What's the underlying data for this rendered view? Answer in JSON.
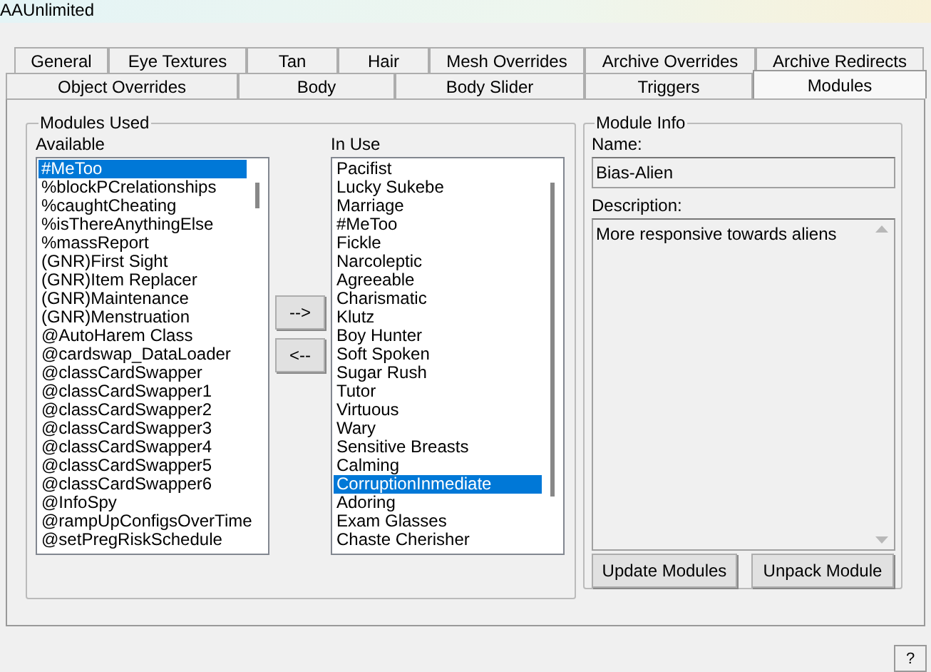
{
  "window": {
    "title": "AAUnlimited"
  },
  "tab_rows": [
    [
      {
        "label": "General",
        "selected": false
      },
      {
        "label": "Eye Textures",
        "selected": false
      },
      {
        "label": "Tan",
        "selected": false
      },
      {
        "label": "Hair",
        "selected": false
      },
      {
        "label": "Mesh Overrides",
        "selected": false
      },
      {
        "label": "Archive Overrides",
        "selected": false
      },
      {
        "label": "Archive Redirects",
        "selected": false
      }
    ],
    [
      {
        "label": "Object Overrides",
        "selected": false
      },
      {
        "label": "Body",
        "selected": false
      },
      {
        "label": "Body Slider",
        "selected": false
      },
      {
        "label": "Triggers",
        "selected": false
      },
      {
        "label": "Modules",
        "selected": true
      }
    ]
  ],
  "modules_used": {
    "title": "Modules Used",
    "available": {
      "label": "Available",
      "items": [
        {
          "text": "#MeToo",
          "selected": true
        },
        {
          "text": "%blockPCrelationships",
          "selected": false
        },
        {
          "text": "%caughtCheating",
          "selected": false
        },
        {
          "text": "%isThereAnythingElse",
          "selected": false
        },
        {
          "text": "%massReport",
          "selected": false
        },
        {
          "text": "(GNR)First Sight",
          "selected": false
        },
        {
          "text": "(GNR)Item Replacer",
          "selected": false
        },
        {
          "text": "(GNR)Maintenance",
          "selected": false
        },
        {
          "text": "(GNR)Menstruation",
          "selected": false
        },
        {
          "text": "@AutoHarem Class",
          "selected": false
        },
        {
          "text": "@cardswap_DataLoader",
          "selected": false
        },
        {
          "text": "@classCardSwapper",
          "selected": false
        },
        {
          "text": "@classCardSwapper1",
          "selected": false
        },
        {
          "text": "@classCardSwapper2",
          "selected": false
        },
        {
          "text": "@classCardSwapper3",
          "selected": false
        },
        {
          "text": "@classCardSwapper4",
          "selected": false
        },
        {
          "text": "@classCardSwapper5",
          "selected": false
        },
        {
          "text": "@classCardSwapper6",
          "selected": false
        },
        {
          "text": "@InfoSpy",
          "selected": false
        },
        {
          "text": "@rampUpConfigsOverTime",
          "selected": false
        },
        {
          "text": "@setPregRiskSchedule",
          "selected": false
        }
      ]
    },
    "add_button": "-->",
    "remove_button": "<--",
    "in_use": {
      "label": "In Use",
      "items": [
        {
          "text": "Pacifist",
          "selected": false
        },
        {
          "text": "Lucky Sukebe",
          "selected": false
        },
        {
          "text": "Marriage",
          "selected": false
        },
        {
          "text": "#MeToo",
          "selected": false
        },
        {
          "text": "Fickle",
          "selected": false
        },
        {
          "text": "Narcoleptic",
          "selected": false
        },
        {
          "text": "Agreeable",
          "selected": false
        },
        {
          "text": "Charismatic",
          "selected": false
        },
        {
          "text": "Klutz",
          "selected": false
        },
        {
          "text": "Boy Hunter",
          "selected": false
        },
        {
          "text": "Soft Spoken",
          "selected": false
        },
        {
          "text": "Sugar Rush",
          "selected": false
        },
        {
          "text": "Tutor",
          "selected": false
        },
        {
          "text": "Virtuous",
          "selected": false
        },
        {
          "text": "Wary",
          "selected": false
        },
        {
          "text": "Sensitive Breasts",
          "selected": false
        },
        {
          "text": "Calming",
          "selected": false
        },
        {
          "text": "CorruptionInmediate",
          "selected": true
        },
        {
          "text": "Adoring",
          "selected": false
        },
        {
          "text": "Exam Glasses",
          "selected": false
        },
        {
          "text": "Chaste Cherisher",
          "selected": false
        }
      ]
    }
  },
  "module_info": {
    "title": "Module Info",
    "name_label": "Name:",
    "name_value": "Bias-Alien",
    "description_label": "Description:",
    "description_value": "More responsive towards aliens",
    "buttons": [
      "Update Modules",
      "Unpack Module"
    ]
  },
  "help_button": "?"
}
